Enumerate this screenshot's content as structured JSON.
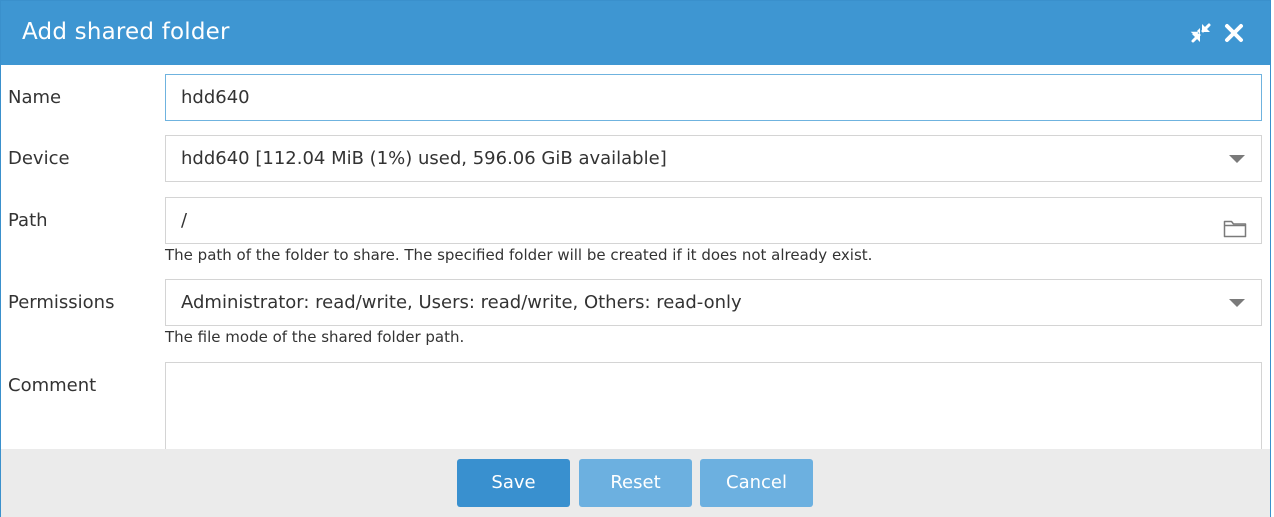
{
  "dialog": {
    "title": "Add shared folder",
    "collapse_icon": "collapse-icon",
    "close_icon": "close-icon"
  },
  "form": {
    "name": {
      "label": "Name",
      "value": "hdd640"
    },
    "device": {
      "label": "Device",
      "value": "hdd640 [112.04 MiB (1%) used, 596.06 GiB available]",
      "icon": "dropdown-arrow-icon"
    },
    "path": {
      "label": "Path",
      "value": "/",
      "hint": "The path of the folder to share. The specified folder will be created if it does not already exist.",
      "icon": "folder-icon"
    },
    "permissions": {
      "label": "Permissions",
      "value": "Administrator: read/write, Users: read/write, Others: read-only",
      "hint": "The file mode of the shared folder path.",
      "icon": "dropdown-arrow-icon"
    },
    "comment": {
      "label": "Comment",
      "value": ""
    }
  },
  "buttons": {
    "save": "Save",
    "reset": "Reset",
    "cancel": "Cancel"
  },
  "colors": {
    "titlebar": "#3e96d2",
    "primary_button": "#3990cf",
    "secondary_button": "#6cb0e0",
    "footer": "#ebebeb"
  }
}
